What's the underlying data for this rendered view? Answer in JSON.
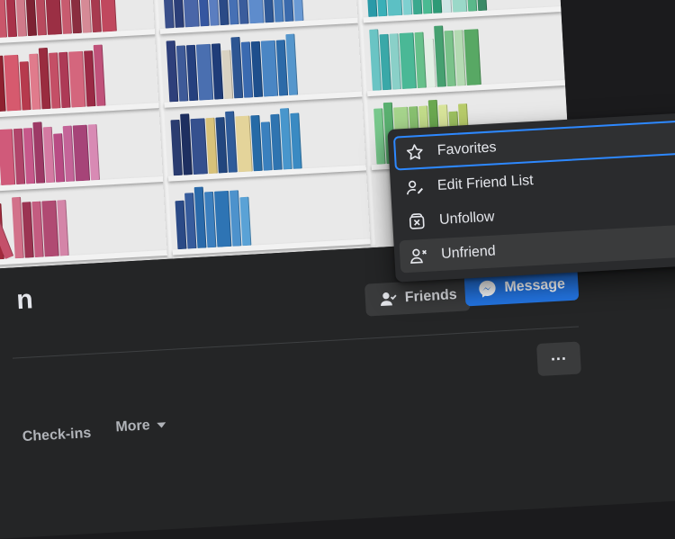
{
  "menu": {
    "items": [
      {
        "label": "Favorites",
        "icon": "star-icon"
      },
      {
        "label": "Edit Friend List",
        "icon": "person-edit-icon"
      },
      {
        "label": "Unfollow",
        "icon": "unfollow-icon"
      },
      {
        "label": "Unfriend",
        "icon": "person-remove-icon"
      }
    ]
  },
  "profile": {
    "name_fragment": "n",
    "friends_label": "Friends",
    "message_label": "Message",
    "more_label": "···"
  },
  "tabs": {
    "checkins": "Check-ins",
    "more": "More"
  },
  "colors": {
    "accent": "#2374e1",
    "focus_ring": "#2d88ff",
    "surface": "#242526",
    "button": "#3a3b3c"
  }
}
